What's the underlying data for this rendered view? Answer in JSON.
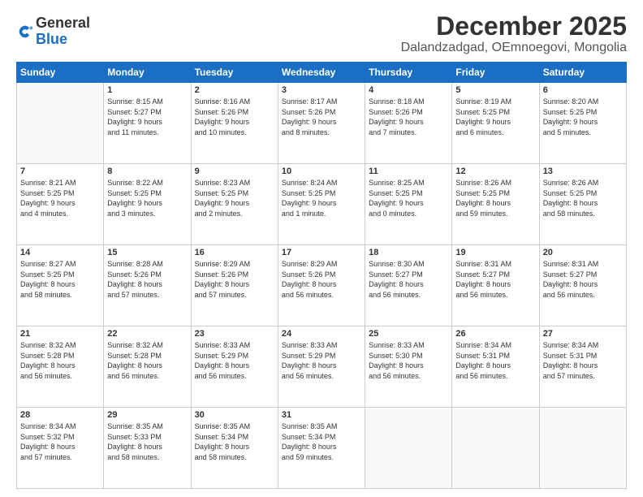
{
  "logo": {
    "general": "General",
    "blue": "Blue"
  },
  "header": {
    "month": "December 2025",
    "location": "Dalandzadgad, OEmnoegovi, Mongolia"
  },
  "weekdays": [
    "Sunday",
    "Monday",
    "Tuesday",
    "Wednesday",
    "Thursday",
    "Friday",
    "Saturday"
  ],
  "weeks": [
    [
      {
        "day": "",
        "info": ""
      },
      {
        "day": "1",
        "info": "Sunrise: 8:15 AM\nSunset: 5:27 PM\nDaylight: 9 hours\nand 11 minutes."
      },
      {
        "day": "2",
        "info": "Sunrise: 8:16 AM\nSunset: 5:26 PM\nDaylight: 9 hours\nand 10 minutes."
      },
      {
        "day": "3",
        "info": "Sunrise: 8:17 AM\nSunset: 5:26 PM\nDaylight: 9 hours\nand 8 minutes."
      },
      {
        "day": "4",
        "info": "Sunrise: 8:18 AM\nSunset: 5:26 PM\nDaylight: 9 hours\nand 7 minutes."
      },
      {
        "day": "5",
        "info": "Sunrise: 8:19 AM\nSunset: 5:25 PM\nDaylight: 9 hours\nand 6 minutes."
      },
      {
        "day": "6",
        "info": "Sunrise: 8:20 AM\nSunset: 5:25 PM\nDaylight: 9 hours\nand 5 minutes."
      }
    ],
    [
      {
        "day": "7",
        "info": "Sunrise: 8:21 AM\nSunset: 5:25 PM\nDaylight: 9 hours\nand 4 minutes."
      },
      {
        "day": "8",
        "info": "Sunrise: 8:22 AM\nSunset: 5:25 PM\nDaylight: 9 hours\nand 3 minutes."
      },
      {
        "day": "9",
        "info": "Sunrise: 8:23 AM\nSunset: 5:25 PM\nDaylight: 9 hours\nand 2 minutes."
      },
      {
        "day": "10",
        "info": "Sunrise: 8:24 AM\nSunset: 5:25 PM\nDaylight: 9 hours\nand 1 minute."
      },
      {
        "day": "11",
        "info": "Sunrise: 8:25 AM\nSunset: 5:25 PM\nDaylight: 9 hours\nand 0 minutes."
      },
      {
        "day": "12",
        "info": "Sunrise: 8:26 AM\nSunset: 5:25 PM\nDaylight: 8 hours\nand 59 minutes."
      },
      {
        "day": "13",
        "info": "Sunrise: 8:26 AM\nSunset: 5:25 PM\nDaylight: 8 hours\nand 58 minutes."
      }
    ],
    [
      {
        "day": "14",
        "info": "Sunrise: 8:27 AM\nSunset: 5:25 PM\nDaylight: 8 hours\nand 58 minutes."
      },
      {
        "day": "15",
        "info": "Sunrise: 8:28 AM\nSunset: 5:26 PM\nDaylight: 8 hours\nand 57 minutes."
      },
      {
        "day": "16",
        "info": "Sunrise: 8:29 AM\nSunset: 5:26 PM\nDaylight: 8 hours\nand 57 minutes."
      },
      {
        "day": "17",
        "info": "Sunrise: 8:29 AM\nSunset: 5:26 PM\nDaylight: 8 hours\nand 56 minutes."
      },
      {
        "day": "18",
        "info": "Sunrise: 8:30 AM\nSunset: 5:27 PM\nDaylight: 8 hours\nand 56 minutes."
      },
      {
        "day": "19",
        "info": "Sunrise: 8:31 AM\nSunset: 5:27 PM\nDaylight: 8 hours\nand 56 minutes."
      },
      {
        "day": "20",
        "info": "Sunrise: 8:31 AM\nSunset: 5:27 PM\nDaylight: 8 hours\nand 56 minutes."
      }
    ],
    [
      {
        "day": "21",
        "info": "Sunrise: 8:32 AM\nSunset: 5:28 PM\nDaylight: 8 hours\nand 56 minutes."
      },
      {
        "day": "22",
        "info": "Sunrise: 8:32 AM\nSunset: 5:28 PM\nDaylight: 8 hours\nand 56 minutes."
      },
      {
        "day": "23",
        "info": "Sunrise: 8:33 AM\nSunset: 5:29 PM\nDaylight: 8 hours\nand 56 minutes."
      },
      {
        "day": "24",
        "info": "Sunrise: 8:33 AM\nSunset: 5:29 PM\nDaylight: 8 hours\nand 56 minutes."
      },
      {
        "day": "25",
        "info": "Sunrise: 8:33 AM\nSunset: 5:30 PM\nDaylight: 8 hours\nand 56 minutes."
      },
      {
        "day": "26",
        "info": "Sunrise: 8:34 AM\nSunset: 5:31 PM\nDaylight: 8 hours\nand 56 minutes."
      },
      {
        "day": "27",
        "info": "Sunrise: 8:34 AM\nSunset: 5:31 PM\nDaylight: 8 hours\nand 57 minutes."
      }
    ],
    [
      {
        "day": "28",
        "info": "Sunrise: 8:34 AM\nSunset: 5:32 PM\nDaylight: 8 hours\nand 57 minutes."
      },
      {
        "day": "29",
        "info": "Sunrise: 8:35 AM\nSunset: 5:33 PM\nDaylight: 8 hours\nand 58 minutes."
      },
      {
        "day": "30",
        "info": "Sunrise: 8:35 AM\nSunset: 5:34 PM\nDaylight: 8 hours\nand 58 minutes."
      },
      {
        "day": "31",
        "info": "Sunrise: 8:35 AM\nSunset: 5:34 PM\nDaylight: 8 hours\nand 59 minutes."
      },
      {
        "day": "",
        "info": ""
      },
      {
        "day": "",
        "info": ""
      },
      {
        "day": "",
        "info": ""
      }
    ]
  ]
}
